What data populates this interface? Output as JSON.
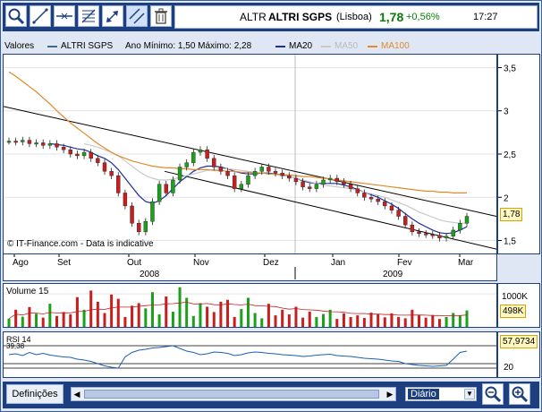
{
  "header": {
    "ticker": "ALTR",
    "name": "ALTRI SGPS",
    "exchange": "(Lisboa)",
    "price": "1,78",
    "change": "+0,56%",
    "time": "17:27"
  },
  "toolbar": {
    "icons": [
      "zoom-icon",
      "line-tool-icon",
      "hline-tool-icon",
      "fibonacci-icon",
      "arrow-tool-icon",
      "channel-tool-icon",
      "trash-icon"
    ]
  },
  "legend": {
    "label": "Valores",
    "series_name": "ALTRI SGPS",
    "range_text": "Ano Mínimo: 1,50 Máximo: 2,28",
    "ma20": "MA20",
    "ma50": "MA50",
    "ma100": "MA100",
    "colors": {
      "price": "#3a6e8f",
      "ma20": "#1a2fa0",
      "ma50": "#c8c8c8",
      "ma100": "#e08a2c"
    }
  },
  "watermark": "© IT-Finance.com - Data is indicative",
  "price_tag": "1,78",
  "x_months": [
    "Ago",
    "Set",
    "Out",
    "Nov",
    "Dez",
    "Jan",
    "Fev",
    "Mar"
  ],
  "x_years": [
    "2008",
    "2009"
  ],
  "volume": {
    "label": "Volume 15",
    "tick_high": "1000K",
    "current": "498K"
  },
  "rsi": {
    "label": "RSI 14",
    "threshold_text": "39,38",
    "current": "57,9734",
    "tick_low": "20"
  },
  "bottom": {
    "settings_label": "Definições",
    "period": "Diário"
  },
  "chart_data": [
    {
      "type": "line",
      "title": "",
      "yticks": [
        "3,5",
        "3",
        "2,5",
        "2",
        "1,5"
      ],
      "ylim": [
        1.35,
        3.65
      ],
      "series": [
        {
          "name": "ALTRI SGPS",
          "role": "price",
          "values": [
            2.65,
            2.64,
            2.66,
            2.62,
            2.63,
            2.6,
            2.62,
            2.58,
            2.55,
            2.5,
            2.48,
            2.52,
            2.45,
            2.4,
            2.3,
            2.25,
            2.05,
            1.9,
            1.7,
            1.6,
            1.72,
            1.95,
            2.15,
            2.05,
            2.2,
            2.35,
            2.4,
            2.52,
            2.55,
            2.45,
            2.35,
            2.3,
            2.25,
            2.1,
            2.15,
            2.25,
            2.3,
            2.35,
            2.3,
            2.28,
            2.25,
            2.22,
            2.18,
            2.12,
            2.1,
            2.15,
            2.2,
            2.22,
            2.18,
            2.15,
            2.1,
            2.05,
            2.0,
            1.98,
            1.95,
            1.9,
            1.85,
            1.78,
            1.68,
            1.6,
            1.58,
            1.57,
            1.56,
            1.53,
            1.55,
            1.62,
            1.7,
            1.78
          ]
        },
        {
          "name": "MA20",
          "values": [
            null,
            null,
            null,
            null,
            null,
            null,
            2.62,
            2.61,
            2.6,
            2.58,
            2.56,
            2.55,
            2.52,
            2.48,
            2.45,
            2.4,
            2.32,
            2.22,
            2.12,
            2.02,
            1.95,
            1.93,
            1.96,
            2.02,
            2.1,
            2.18,
            2.24,
            2.3,
            2.34,
            2.36,
            2.36,
            2.35,
            2.33,
            2.3,
            2.28,
            2.27,
            2.27,
            2.28,
            2.28,
            2.27,
            2.26,
            2.24,
            2.22,
            2.19,
            2.17,
            2.16,
            2.16,
            2.16,
            2.16,
            2.14,
            2.12,
            2.09,
            2.06,
            2.03,
            2.0,
            1.96,
            1.92,
            1.87,
            1.81,
            1.75,
            1.7,
            1.66,
            1.62,
            1.59,
            1.58,
            1.59,
            1.62,
            1.66
          ]
        },
        {
          "name": "MA50",
          "values": [
            null,
            null,
            null,
            null,
            null,
            null,
            null,
            null,
            null,
            null,
            null,
            2.62,
            2.6,
            2.58,
            2.55,
            2.52,
            2.48,
            2.42,
            2.36,
            2.3,
            2.25,
            2.22,
            2.2,
            2.2,
            2.21,
            2.23,
            2.25,
            2.27,
            2.29,
            2.31,
            2.32,
            2.33,
            2.33,
            2.32,
            2.31,
            2.3,
            2.29,
            2.28,
            2.27,
            2.26,
            2.25,
            2.24,
            2.22,
            2.2,
            2.18,
            2.16,
            2.14,
            2.13,
            2.12,
            2.11,
            2.1,
            2.08,
            2.06,
            2.04,
            2.02,
            2.0,
            1.97,
            1.94,
            1.91,
            1.87,
            1.83,
            1.8,
            1.77,
            1.74,
            1.72,
            1.71,
            1.7,
            1.7
          ]
        },
        {
          "name": "MA100",
          "values": [
            3.45,
            3.4,
            3.34,
            3.28,
            3.22,
            3.15,
            3.08,
            3.0,
            2.93,
            2.86,
            2.8,
            2.74,
            2.68,
            2.62,
            2.57,
            2.52,
            2.48,
            2.45,
            2.42,
            2.4,
            2.38,
            2.36,
            2.35,
            2.34,
            2.34,
            2.33,
            2.33,
            2.32,
            2.32,
            2.32,
            2.31,
            2.31,
            2.3,
            2.3,
            2.29,
            2.29,
            2.28,
            2.28,
            2.27,
            2.27,
            2.26,
            2.26,
            2.25,
            2.24,
            2.24,
            2.23,
            2.22,
            2.21,
            2.2,
            2.19,
            2.18,
            2.17,
            2.16,
            2.15,
            2.14,
            2.13,
            2.12,
            2.11,
            2.1,
            2.09,
            2.08,
            2.07,
            2.07,
            2.06,
            2.06,
            2.05,
            2.05,
            2.05
          ]
        }
      ]
    },
    {
      "type": "bar",
      "title": "",
      "ylim": [
        0,
        1300
      ],
      "series": [
        {
          "name": "Volume 15",
          "values": [
            250,
            520,
            310,
            600,
            400,
            280,
            700,
            330,
            450,
            380,
            900,
            520,
            1100,
            760,
            420,
            980,
            850,
            300,
            640,
            720,
            560,
            1050,
            380,
            920,
            460,
            1200,
            880,
            330,
            720,
            610,
            450,
            760,
            820,
            300,
            540,
            880,
            420,
            260,
            700,
            350,
            520,
            380,
            610,
            280,
            460,
            300,
            390,
            520,
            240,
            410,
            300,
            350,
            270,
            430,
            380,
            290,
            410,
            300,
            260,
            520,
            350,
            280,
            360,
            240,
            300,
            420,
            350,
            498
          ]
        }
      ]
    },
    {
      "type": "line",
      "title": "",
      "ylim": [
        0,
        100
      ],
      "series": [
        {
          "name": "RSI 14",
          "values": [
            50,
            52,
            48,
            55,
            50,
            53,
            49,
            47,
            45,
            44,
            40,
            38,
            35,
            30,
            25,
            22,
            20,
            45,
            55,
            60,
            62,
            65,
            66,
            68,
            70,
            64,
            58,
            55,
            50,
            52,
            56,
            55,
            53,
            48,
            50,
            54,
            56,
            55,
            53,
            52,
            50,
            49,
            48,
            46,
            47,
            49,
            50,
            51,
            48,
            47,
            46,
            44,
            42,
            41,
            40,
            38,
            36,
            35,
            30,
            28,
            26,
            25,
            24,
            25,
            26,
            40,
            55,
            58
          ]
        }
      ]
    }
  ]
}
